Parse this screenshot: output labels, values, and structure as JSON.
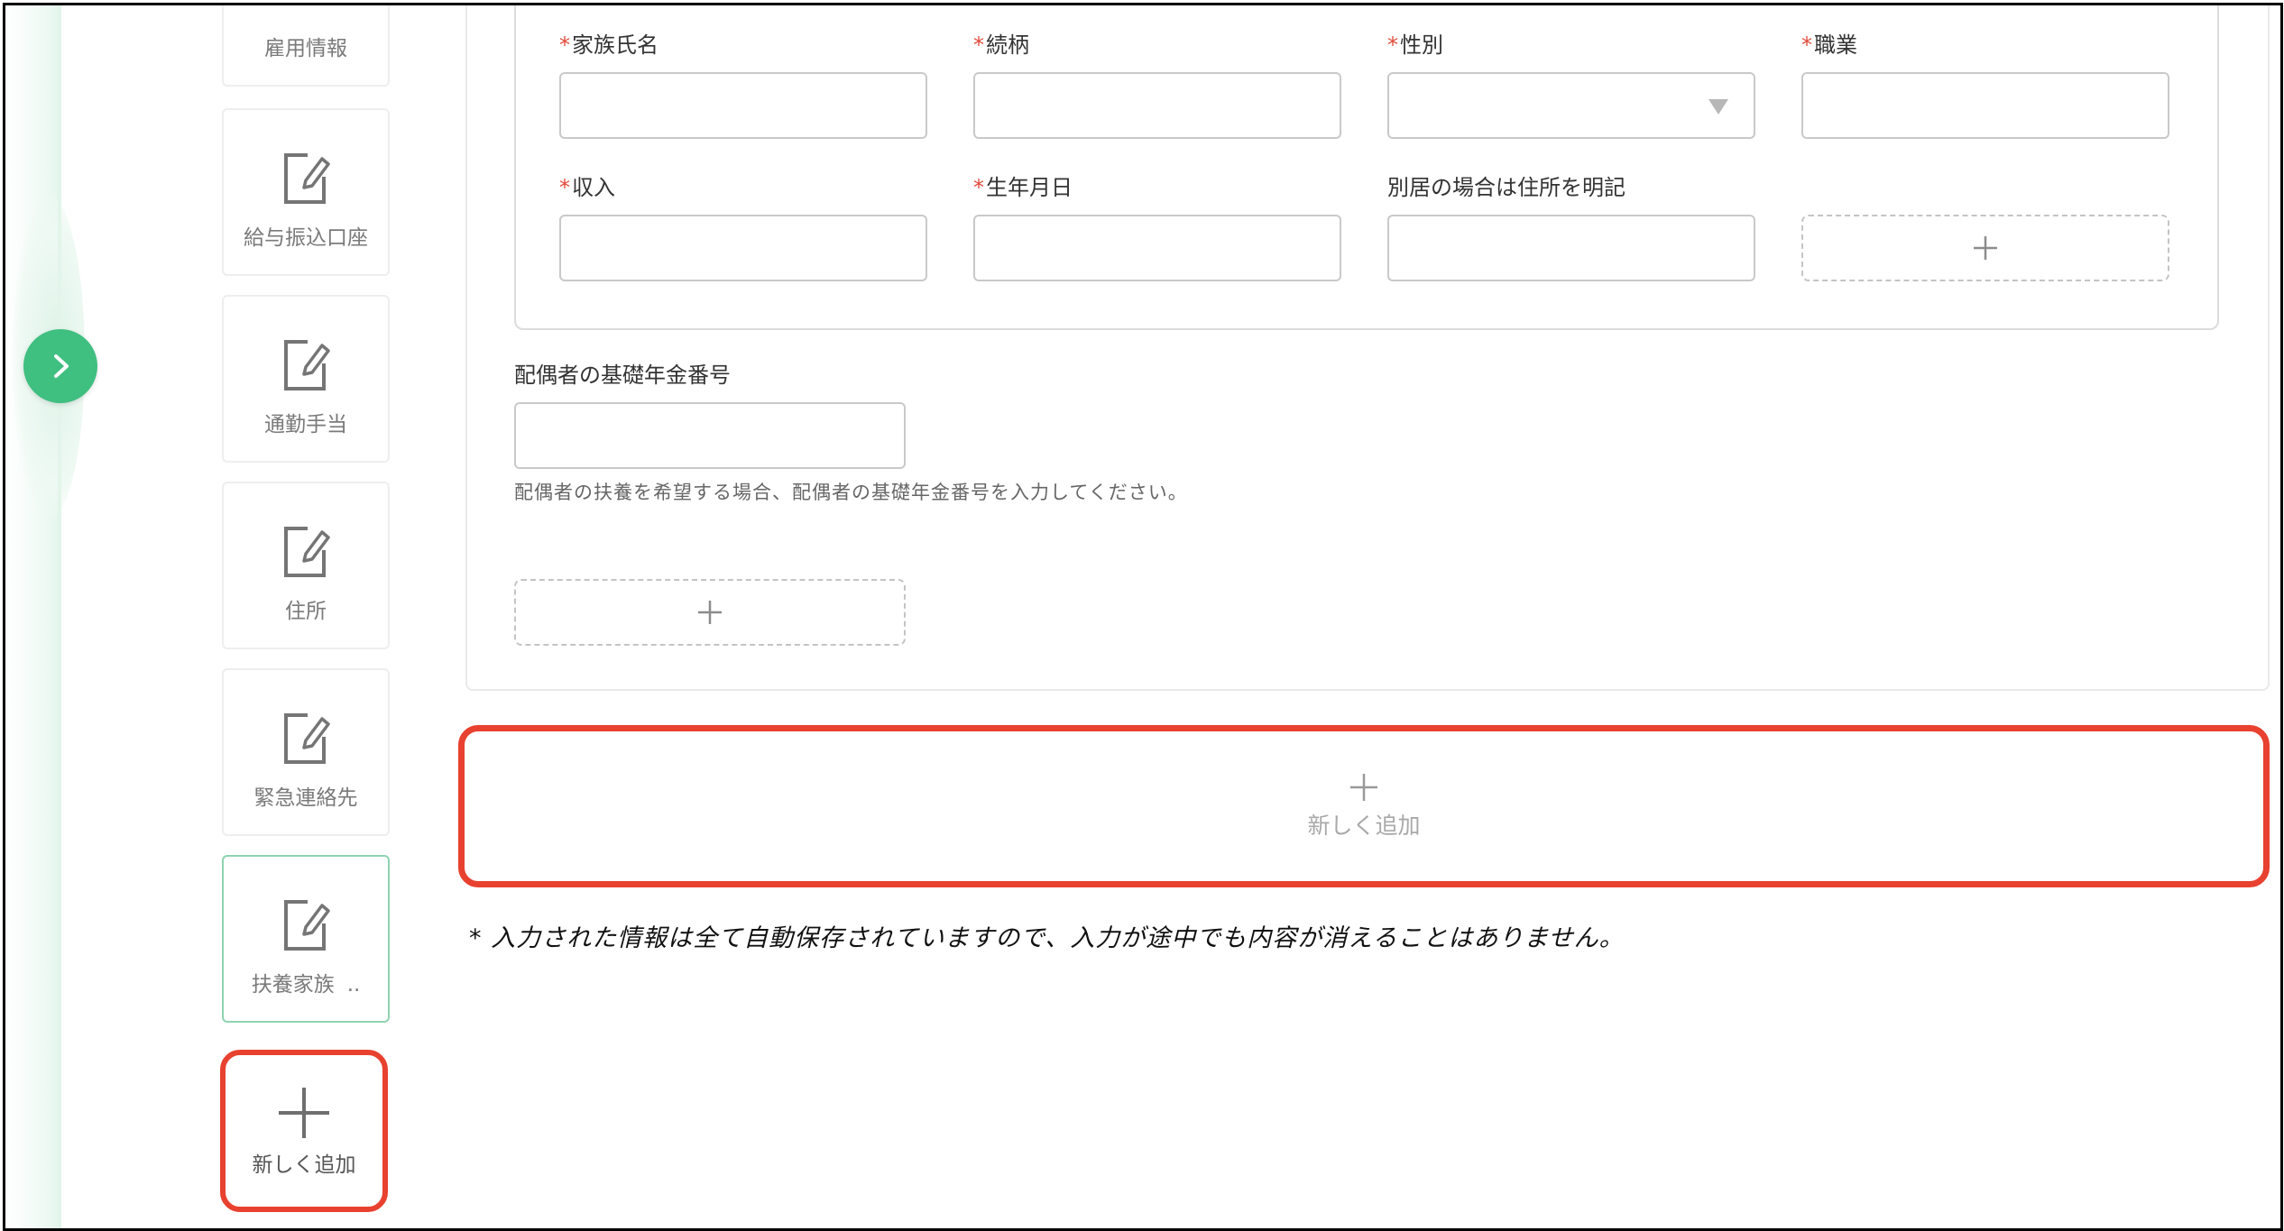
{
  "sidebar": {
    "items": [
      {
        "label": "雇用情報"
      },
      {
        "label": "給与振込口座"
      },
      {
        "label": "通勤手当"
      },
      {
        "label": "住所"
      },
      {
        "label": "緊急連絡先"
      },
      {
        "label": "扶養家族",
        "suffix": "..",
        "active": true
      }
    ],
    "add_label": "新しく追加",
    "icon": "edit-document-icon"
  },
  "form": {
    "required_mark": "*",
    "family_name_label": "家族氏名",
    "relationship_label": "続柄",
    "gender_label": "性別",
    "occupation_label": "職業",
    "income_label": "収入",
    "birthdate_label": "生年月日",
    "address_label": "別居の場合は住所を明記",
    "values": {
      "family_name": "",
      "relationship": "",
      "gender": "",
      "occupation": "",
      "income": "",
      "birthdate": "",
      "address": ""
    },
    "spouse_pension_label": "配偶者の基礎年金番号",
    "spouse_pension_value": "",
    "spouse_pension_help": "配偶者の扶養を希望する場合、配偶者の基礎年金番号を入力してください。"
  },
  "main": {
    "add_new_label": "新しく追加",
    "autosave_note": "* 入力された情報は全て自動保存されていますので、入力が途中でも内容が消えることはありません。"
  },
  "colors": {
    "accent_green": "#3fbf80",
    "required_red": "#e24a3b",
    "highlight_red": "#e8412f"
  }
}
